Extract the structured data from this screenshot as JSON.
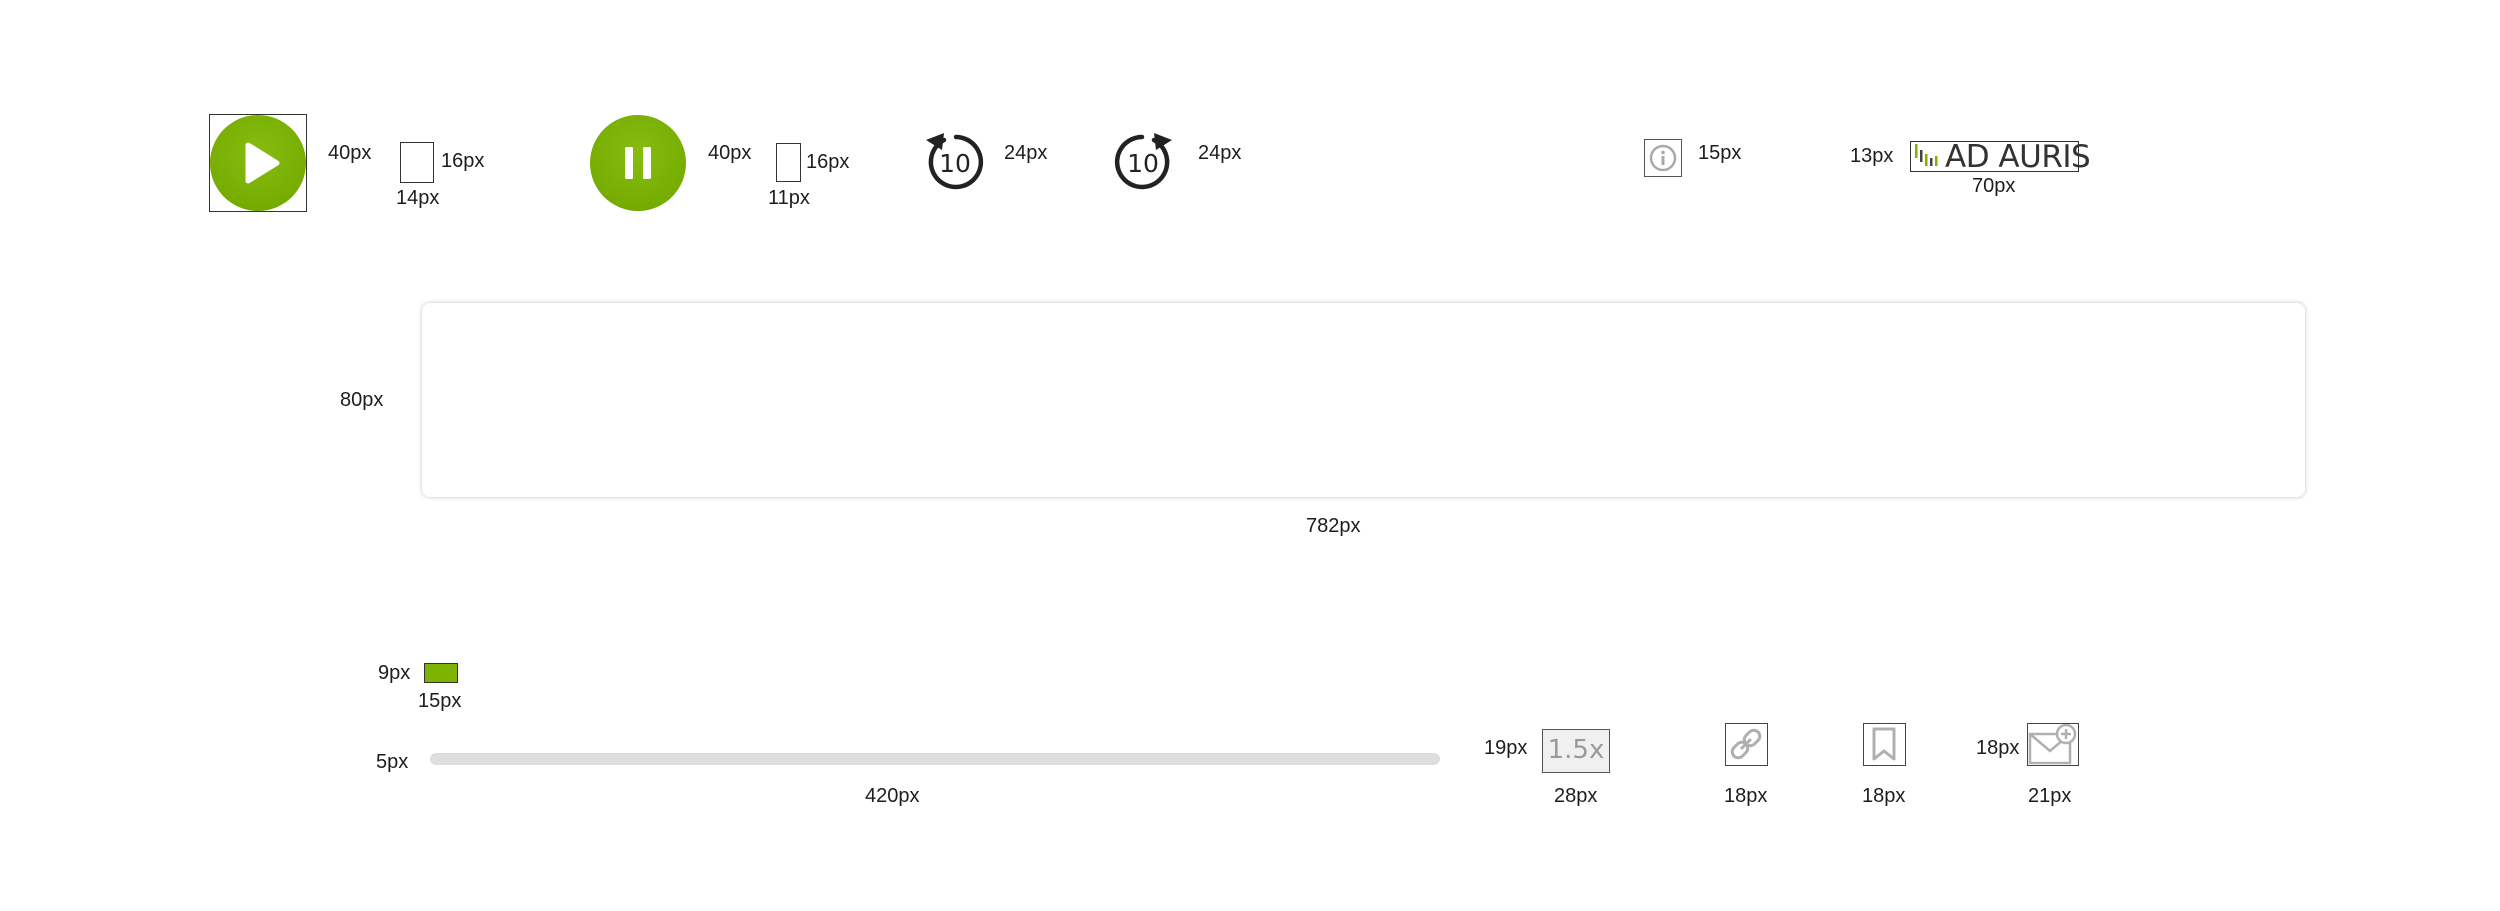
{
  "controls": {
    "play": {
      "size_label": "40px",
      "icon_w_label": "14px",
      "icon_h_label": "16px"
    },
    "pause": {
      "size_label": "40px",
      "icon_w_label": "11px",
      "icon_h_label": "16px"
    },
    "rewind": {
      "number": "10",
      "size_label": "24px"
    },
    "forward": {
      "number": "10",
      "size_label": "24px"
    },
    "info": {
      "size_label": "15px"
    },
    "logo": {
      "text": "AD AURIS",
      "height_label": "13px",
      "width_label": "70px"
    }
  },
  "panel": {
    "height_label": "80px",
    "width_label": "782px"
  },
  "scrubber": {
    "thumb_height_label": "9px",
    "thumb_width_label": "15px"
  },
  "progress": {
    "height_label": "5px",
    "width_label": "420px",
    "value": 0
  },
  "speed": {
    "value": "1.5x",
    "height_label": "19px",
    "width_label": "28px"
  },
  "link": {
    "size_label": "18px"
  },
  "bookmark": {
    "size_label": "18px"
  },
  "email": {
    "height_label": "18px",
    "width_label": "21px"
  },
  "colors": {
    "accent": "#7cb400",
    "track": "#dedede",
    "icon_gray": "#9a9a9a"
  }
}
